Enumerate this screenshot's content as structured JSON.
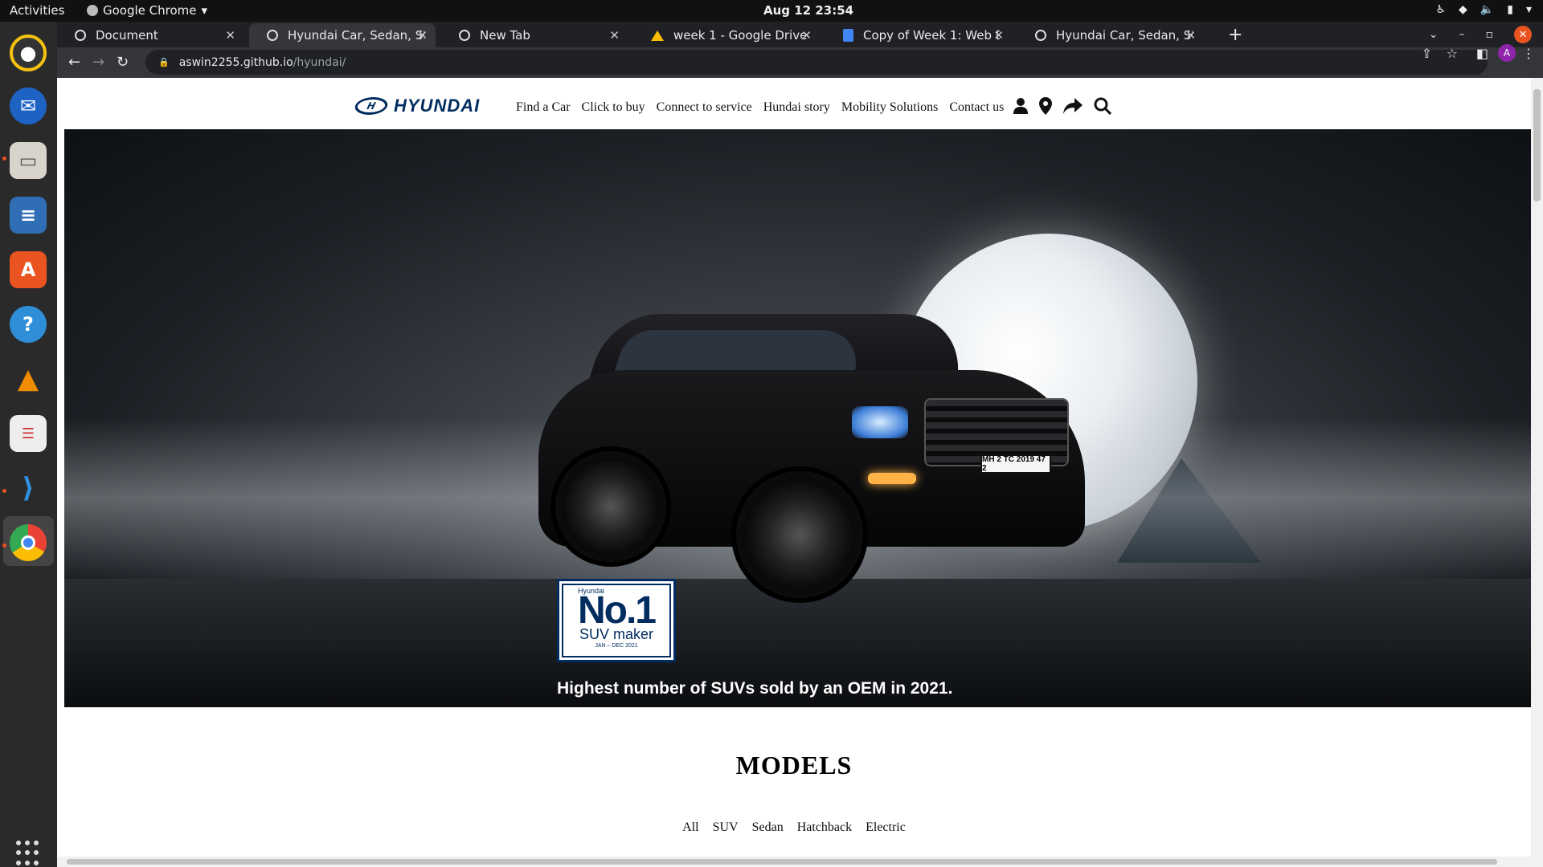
{
  "os": {
    "activities": "Activities",
    "app_name": "Google Chrome",
    "clock": "Aug 12  23:54"
  },
  "browser": {
    "tabs": [
      {
        "title": "Document",
        "icon": "globe-icon",
        "active": false
      },
      {
        "title": "Hyundai Car, Sedan, SUV,",
        "icon": "globe-icon",
        "active": true
      },
      {
        "title": "New Tab",
        "icon": "globe-icon",
        "active": false
      },
      {
        "title": "week 1 - Google Drive",
        "icon": "drive-icon",
        "active": false
      },
      {
        "title": "Copy of Week 1: Web Desi",
        "icon": "docs-icon",
        "active": false
      },
      {
        "title": "Hyundai Car, Sedan, SUV,",
        "icon": "globe-icon",
        "active": false
      }
    ],
    "url_host": "aswin2255.github.io",
    "url_path": "/hyundai/",
    "profile_initial": "A"
  },
  "site": {
    "logo_text": "HYUNDAI",
    "menu": [
      "Find a Car",
      "Click to buy",
      "Connect to service",
      "Hundai story",
      "Mobility Solutions",
      "Contact us"
    ],
    "nav_icons": [
      "user-icon",
      "location-pin-icon",
      "share-arrow-icon",
      "search-icon"
    ],
    "hero": {
      "badge_brand": "Hyundai",
      "badge_big": "No.1",
      "badge_sub": "SUV maker",
      "badge_period": "JAN – DEC 2021",
      "plate": "MH 2 TC 2019 47 2",
      "caption": "Highest number of SUVs sold by an OEM in 2021."
    },
    "models_title": "MODELS",
    "filters": [
      "All",
      "SUV",
      "Sedan",
      "Hatchback",
      "Electric"
    ]
  },
  "colors": {
    "brand": "#002c5f",
    "ubuntu_orange": "#e95420"
  }
}
